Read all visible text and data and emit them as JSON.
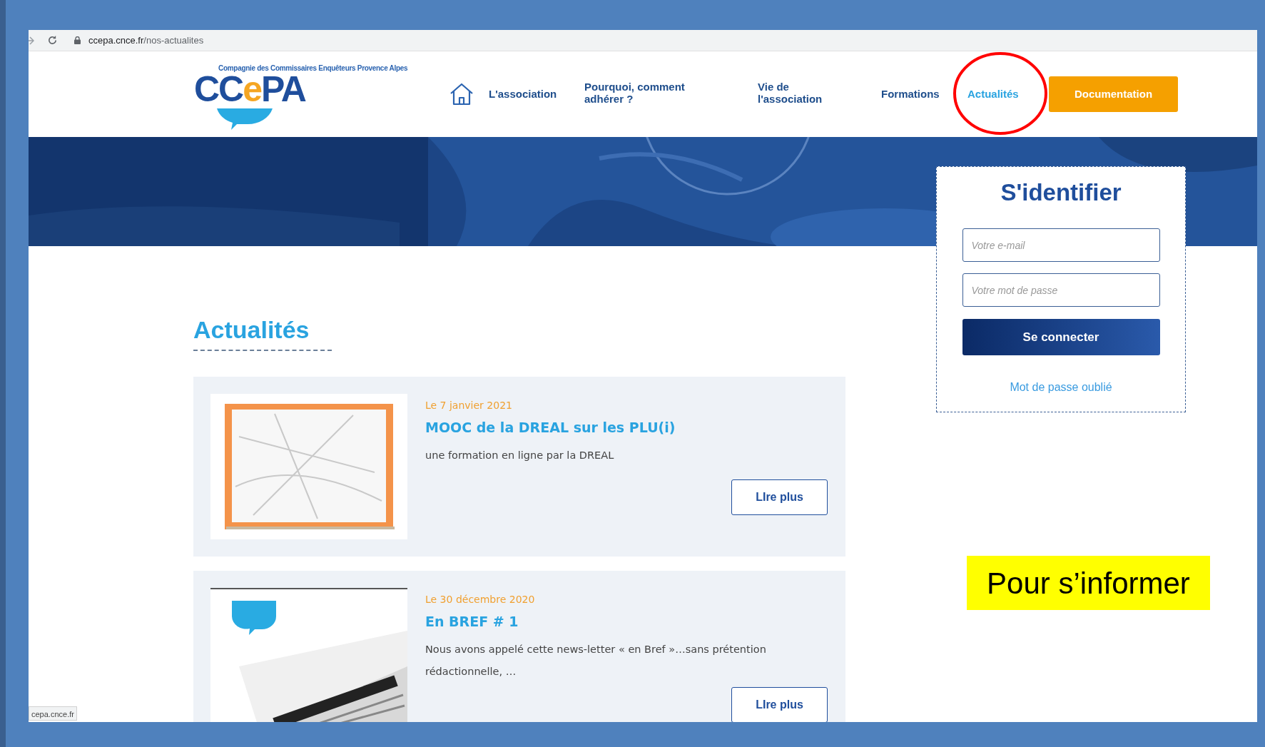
{
  "browser": {
    "url_host": "ccepa.cnce.fr",
    "url_path": "/nos-actualites",
    "status_link": "cepa.cnce.fr"
  },
  "header": {
    "logo_tagline": "Compagnie des Commissaires Enquêteurs Provence Alpes",
    "logo_parts": [
      {
        "text": "CC",
        "color": "#1f4e9c"
      },
      {
        "text": "e",
        "color": "#f5a623"
      },
      {
        "text": "PA",
        "color": "#1f4e9c"
      }
    ],
    "nav": [
      {
        "label": "L'association",
        "selected": false
      },
      {
        "label": "Pourquoi, comment adhérer ?",
        "selected": false
      },
      {
        "label": "Vie de l'association",
        "selected": false
      },
      {
        "label": "Formations",
        "selected": false
      },
      {
        "label": "Actualités",
        "selected": true
      }
    ],
    "cta": "Documentation"
  },
  "login": {
    "title": "S'identifier",
    "email_placeholder": "Votre e-mail",
    "password_placeholder": "Votre mot de passe",
    "submit": "Se connecter",
    "forgot": "Mot de passe oublié"
  },
  "news": {
    "title": "Actualités",
    "items": [
      {
        "date": "Le 7 janvier 2021",
        "title": "MOOC de la DREAL sur les PLU(i)",
        "summary": "une formation en ligne par la DREAL",
        "button": "LIre plus"
      },
      {
        "date": "Le 30 décembre 2020",
        "title": "En BREF # 1",
        "summary": "Nous avons appelé cette news-letter « en Bref »…sans prétention rédactionnelle, …",
        "button": "LIre plus"
      }
    ]
  },
  "annotation": "Pour s’informer"
}
